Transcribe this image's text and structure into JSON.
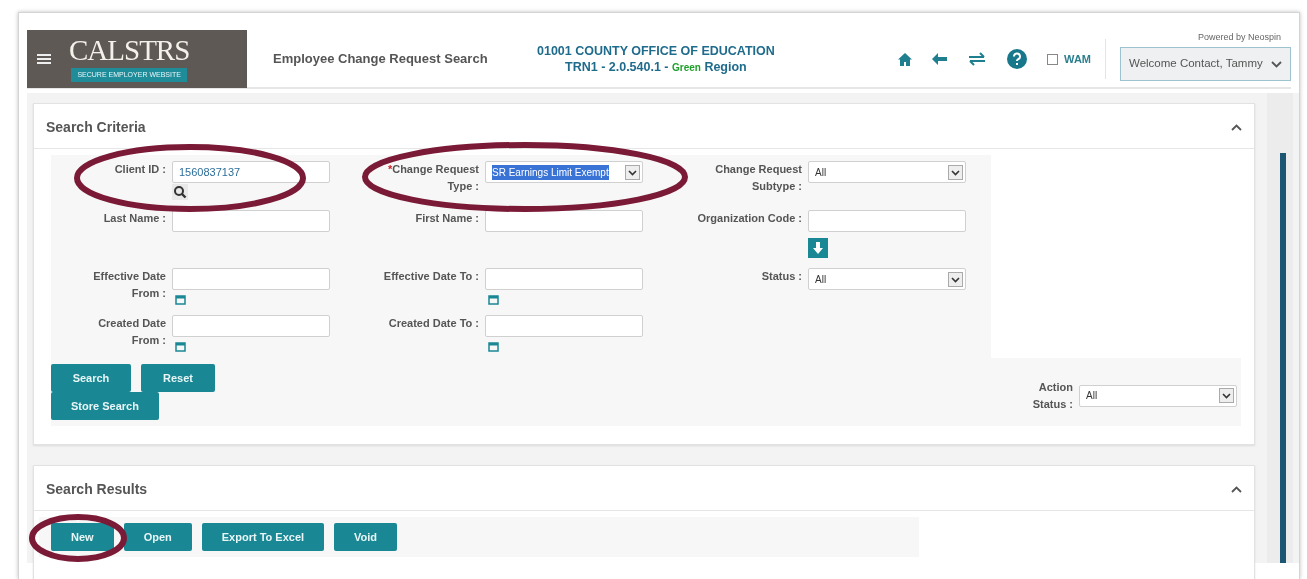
{
  "header": {
    "logo": {
      "title": "CALSTRS",
      "subtitle": "SECURE EMPLOYER WEBSITE"
    },
    "page_title": "Employee Change Request Search",
    "organization": "01001 COUNTY OFFICE OF EDUCATION",
    "environment": "TRN1 - 2.0.540.1 -",
    "region_tag": "Green",
    "region_label": "Region",
    "wam": {
      "label": "WAM",
      "checked": false
    },
    "powered_by": "Powered by Neospin",
    "user_menu": "Welcome Contact, Tammy"
  },
  "search_criteria": {
    "title": "Search Criteria",
    "expanded": true,
    "required_marker": "*",
    "fields": [
      {
        "kind": "text",
        "label": "Client ID :",
        "value": "1560837137",
        "required": false,
        "addon": {
          "kind": "search"
        }
      },
      {
        "kind": "select",
        "label": "Change Request Type :",
        "value": "SR Earnings Limit Exempt",
        "required": true,
        "highlighted": true
      },
      {
        "kind": "select",
        "label": "Change Request Subtype :",
        "value": "All",
        "required": false,
        "highlighted": false
      },
      {
        "kind": "text",
        "label": "Last Name :",
        "required": false
      },
      {
        "kind": "text",
        "label": "First Name :",
        "required": false
      },
      {
        "kind": "text",
        "label": "Organization Code :",
        "required": false,
        "addon": {
          "kind": "download"
        }
      },
      {
        "kind": "text",
        "label": "Effective Date From :",
        "required": false,
        "addon": {
          "kind": "calendar"
        }
      },
      {
        "kind": "text",
        "label": "Effective Date To :",
        "required": false,
        "addon": {
          "kind": "calendar"
        }
      },
      {
        "kind": "select",
        "label": "Status :",
        "value": "All",
        "required": false,
        "highlighted": false
      },
      {
        "kind": "text",
        "label": "Created Date From :",
        "required": false,
        "addon": {
          "kind": "calendar"
        }
      },
      {
        "kind": "text",
        "label": "Created Date To :",
        "required": false,
        "addon": {
          "kind": "calendar"
        }
      }
    ],
    "buttons": [
      "Search",
      "Reset",
      "Store Search"
    ],
    "action_status": {
      "label": "Action Status :",
      "value": "All"
    }
  },
  "search_results": {
    "title": "Search Results",
    "expanded": true,
    "buttons": [
      "New",
      "Open",
      "Export To Excel",
      "Void"
    ]
  }
}
